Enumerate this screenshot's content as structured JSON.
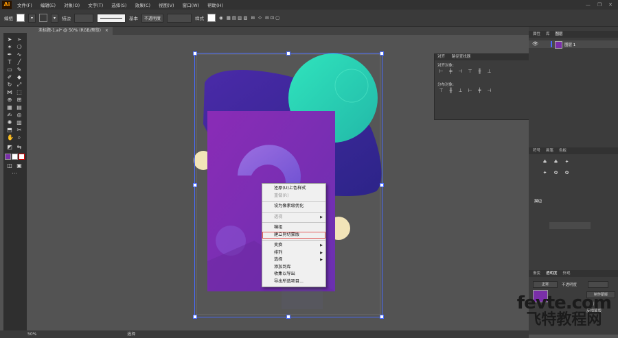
{
  "app": {
    "logo_text": "Ai"
  },
  "menubar": {
    "items": [
      "文件(F)",
      "编辑(E)",
      "对象(O)",
      "文字(T)",
      "选择(S)",
      "效果(C)",
      "视图(V)",
      "窗口(W)",
      "帮助(H)"
    ],
    "window_controls": [
      "—",
      "❐",
      "✕"
    ]
  },
  "control_bar": {
    "no_selection": "编组",
    "stroke_label": "描边",
    "stroke_profile": "基本",
    "opacity_label": "不透明度",
    "style_label": "样式"
  },
  "document_tab": {
    "label": "未标题-1.ai* @ 50% (RGB/预览)",
    "close": "×"
  },
  "context_menu": {
    "items": [
      {
        "label": "还原(U)上色样式",
        "disabled": false,
        "submenu": false
      },
      {
        "label": "重做(R)",
        "disabled": true,
        "submenu": false
      },
      {
        "sep": true
      },
      {
        "label": "设为像素级优化",
        "disabled": false,
        "submenu": false
      },
      {
        "sep": true
      },
      {
        "label": "透视",
        "disabled": true,
        "submenu": true
      },
      {
        "sep": true
      },
      {
        "label": "编组",
        "disabled": false,
        "submenu": false
      },
      {
        "label": "建立剪切蒙版",
        "disabled": false,
        "submenu": false,
        "highlight": true
      },
      {
        "sep": true
      },
      {
        "label": "变换",
        "disabled": false,
        "submenu": true
      },
      {
        "label": "排列",
        "disabled": false,
        "submenu": true
      },
      {
        "label": "选择",
        "disabled": false,
        "submenu": true
      },
      {
        "label": "添加到库",
        "disabled": false,
        "submenu": false
      },
      {
        "label": "收集以导出",
        "disabled": false,
        "submenu": false
      },
      {
        "label": "导出所选项目...",
        "disabled": false,
        "submenu": false
      }
    ]
  },
  "align_panel": {
    "tabs": [
      "对齐",
      "路径查找器"
    ],
    "align_objects_label": "对齐对象:",
    "distribute_objects_label": "分布对象:"
  },
  "layers_panel": {
    "tabs": [
      "属性",
      "库",
      "图层"
    ],
    "layer_name": "图层 1"
  },
  "symbols_panel": {
    "tabs": [
      "符号",
      "画笔",
      "色板"
    ]
  },
  "stroke_panel": {
    "title": "描边"
  },
  "transparency_panel": {
    "tabs": [
      "渐变",
      "透明度",
      "外观"
    ],
    "blend_mode": "正常",
    "opacity_label": "不透明度",
    "make_mask_button": "制作蒙版",
    "clip_label": "剪切",
    "invert_label": "反相蒙版"
  },
  "status_bar": {
    "zoom": "50%",
    "tool": "选择"
  },
  "watermark": {
    "line1": "fevte.com",
    "line2": "飞特教程网"
  },
  "colors": {
    "purple_rect": "#7a2fa8",
    "teal_circle": "#2fd8b4",
    "navy_blob": "#34249a",
    "cream_circle": "#f2e4b8",
    "selection": "#4a6cff"
  }
}
